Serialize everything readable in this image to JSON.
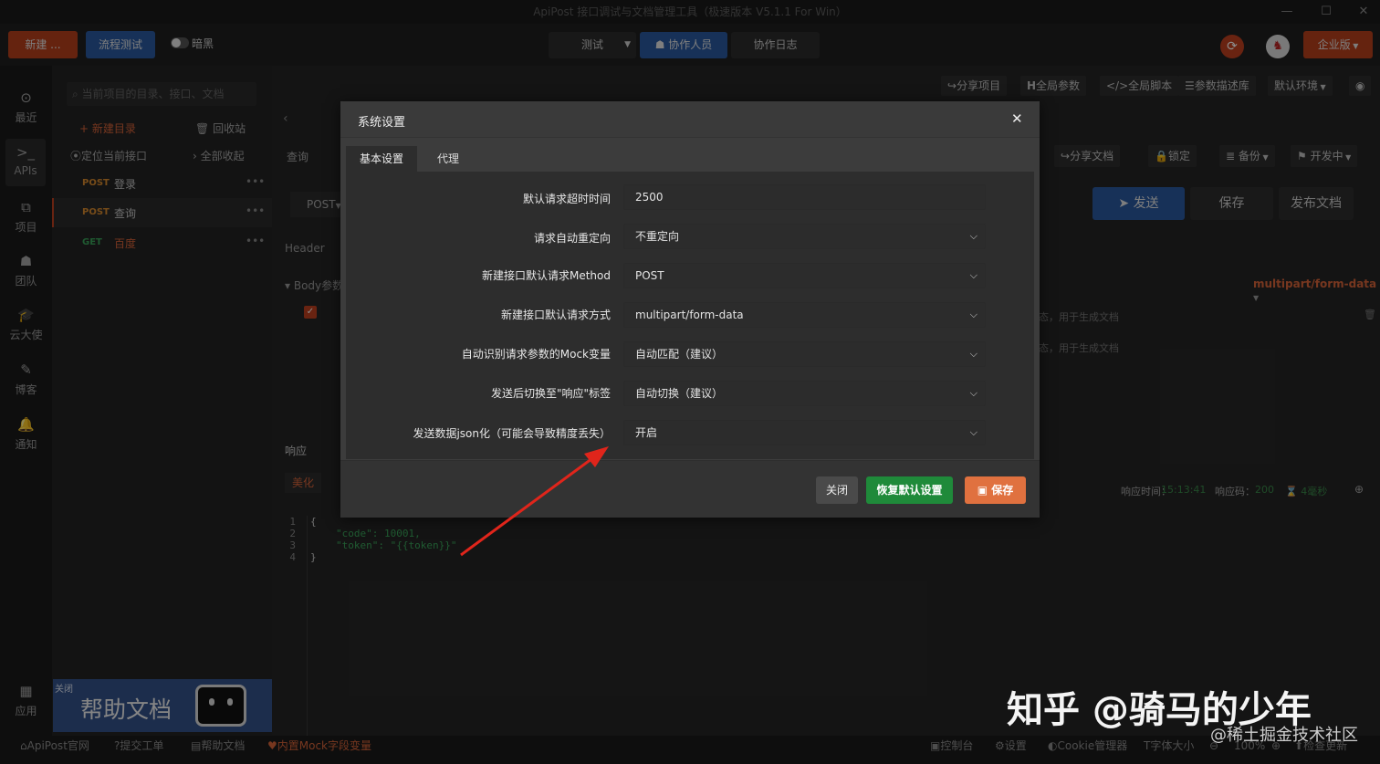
{
  "window": {
    "title": "ApiPost 接口调试与文档管理工具（极速版本 V5.1.1 For Win）"
  },
  "topbar": {
    "new_btn": "新建 ...",
    "flow_btn": "流程测试",
    "dark_toggle": "暗黑",
    "env_select": "测试",
    "collab_btn": "协作人员",
    "collab_log_btn": "协作日志",
    "edition_btn": "企业版"
  },
  "sidebar": {
    "items": [
      {
        "label": "最近",
        "icon": "clock-icon",
        "glyph": "⊙"
      },
      {
        "label": "APIs",
        "icon": "terminal-icon",
        "glyph": ">_"
      },
      {
        "label": "项目",
        "icon": "project-icon",
        "glyph": "⧉"
      },
      {
        "label": "团队",
        "icon": "team-icon",
        "glyph": "☗"
      },
      {
        "label": "云大使",
        "icon": "graduation-icon",
        "glyph": "🎓"
      },
      {
        "label": "博客",
        "icon": "edit-icon",
        "glyph": "✎"
      },
      {
        "label": "通知",
        "icon": "bell-icon",
        "glyph": "🔔"
      },
      {
        "label": "应用",
        "icon": "apps-icon",
        "glyph": "▦"
      }
    ]
  },
  "tree": {
    "search_placeholder": "当前项目的目录、接口、文档",
    "new_dir": "+ 新建目录",
    "recycle": "回收站",
    "locate": "定位当前接口",
    "collapse": "全部收起",
    "apis": [
      {
        "method": "POST",
        "name": "登录",
        "color": "#d98a2e"
      },
      {
        "method": "POST",
        "name": "查询",
        "color": "#d98a2e"
      },
      {
        "method": "GET",
        "name": "百度",
        "color": "#3aa55a"
      }
    ],
    "help_banner": {
      "close": "关闭",
      "text": "帮助文档"
    }
  },
  "main": {
    "toolbar": [
      "分享项目",
      "全局参数",
      "全局脚本",
      "参数描述库",
      "默认环境"
    ],
    "query_tab": "查询",
    "actions": [
      "分享文档",
      "锁定",
      "备份",
      "开发中"
    ],
    "method": "POST",
    "send_btn": "发送",
    "save_btn": "保存",
    "publish_btn": "发布文档",
    "header_tab": "Header",
    "body_label": "Body参数",
    "content_type": "multipart/form-data",
    "desc_hint": "态，用于生成文档",
    "response_tab": "响应",
    "beautify": "美化",
    "resp_time_label": "响应时间：",
    "resp_time": "15:13:41",
    "resp_code_label": "响应码：",
    "resp_code": "200",
    "resp_dur": "4毫秒",
    "code_lines": [
      "{",
      "\"code\": 10001,",
      "\"token\": \"{{token}}\"",
      "}"
    ],
    "line_nums": [
      "1",
      "2",
      "3",
      "4"
    ]
  },
  "modal": {
    "title": "系统设置",
    "tabs": [
      "基本设置",
      "代理"
    ],
    "rows": [
      {
        "label": "默认请求超时时间",
        "value": "2500",
        "select": false
      },
      {
        "label": "请求自动重定向",
        "value": "不重定向",
        "select": true
      },
      {
        "label": "新建接口默认请求Method",
        "value": "POST",
        "select": true
      },
      {
        "label": "新建接口默认请求方式",
        "value": "multipart/form-data",
        "select": true
      },
      {
        "label": "自动识别请求参数的Mock变量",
        "value": "自动匹配（建议）",
        "select": true
      },
      {
        "label": "发送后切换至\"响应\"标签",
        "value": "自动切换（建议）",
        "select": true
      },
      {
        "label": "发送数据json化（可能会导致精度丢失）",
        "value": "开启",
        "select": true
      }
    ],
    "close_btn": "关闭",
    "reset_btn": "恢复默认设置",
    "save_btn": "保存"
  },
  "statusbar": {
    "left": [
      "ApiPost官网",
      "提交工单",
      "帮助文档",
      "内置Mock字段变量"
    ],
    "right": [
      "控制台",
      "设置",
      "Cookie管理器",
      "字体大小",
      "100%",
      "检查更新"
    ]
  },
  "watermark": {
    "main": "知乎 @骑马的少年",
    "sub": "@稀土掘金技术社区"
  },
  "colors": {
    "accent_red": "#c0401f",
    "accent_blue": "#2b5aa0",
    "green": "#1f8a3a",
    "orange": "#e0713f"
  }
}
